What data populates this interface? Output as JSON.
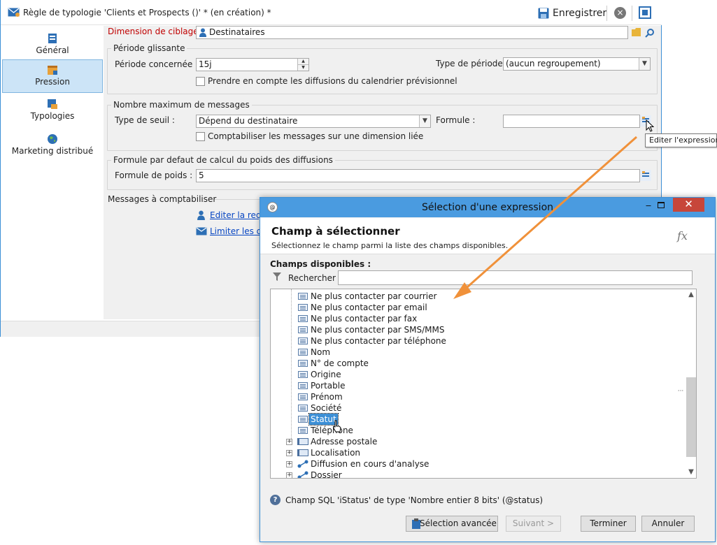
{
  "window": {
    "title": "Règle de typologie 'Clients et Prospects ()' * (en création) *",
    "save_label": "Enregistrer"
  },
  "sidebar": {
    "items": [
      {
        "label": "Général",
        "icon": "general-icon",
        "selected": false
      },
      {
        "label": "Pression",
        "icon": "calendar-icon",
        "selected": true
      },
      {
        "label": "Typologies",
        "icon": "typologies-icon",
        "selected": false
      },
      {
        "label": "Marketing distribué",
        "icon": "globe-icon",
        "selected": false
      }
    ]
  },
  "form": {
    "dimension_label": "Dimension de ciblage :",
    "dimension_value": "Destinataires",
    "periode": {
      "legend": "Période glissante",
      "periode_label": "Période concernée :",
      "periode_value": "15j",
      "type_label": "Type de période :",
      "type_value": "(aucun regroupement)",
      "calendar_checkbox": "Prendre en compte les diffusions du calendrier prévisionnel"
    },
    "max_messages": {
      "legend": "Nombre maximum de messages",
      "seuil_label": "Type de seuil :",
      "seuil_value": "Dépend du destinataire",
      "formule_label": "Formule :",
      "formule_value": "",
      "linked_checkbox": "Comptabiliser les messages sur une dimension liée"
    },
    "poids": {
      "legend": "Formule par defaut de calcul du poids des diffusions",
      "label": "Formule de poids :",
      "value": "5"
    },
    "messages": {
      "legend": "Messages à comptabiliser",
      "link1": "Editer la requ",
      "link2": "Limiter les dif"
    }
  },
  "tooltip": "Editer l'expression",
  "dialog": {
    "title": "Sélection d'une expression",
    "heading": "Champ à sélectionner",
    "subheading": "Sélectionnez le champ parmi la liste des champs disponibles.",
    "fx": "fx",
    "available_label": "Champs disponibles :",
    "search_label": "Rechercher :",
    "search_value": "",
    "tree": [
      {
        "label": "Ne plus contacter par courrier",
        "type": "field"
      },
      {
        "label": "Ne plus contacter par email",
        "type": "field"
      },
      {
        "label": "Ne plus contacter par fax",
        "type": "field"
      },
      {
        "label": "Ne plus contacter par SMS/MMS",
        "type": "field"
      },
      {
        "label": "Ne plus contacter par téléphone",
        "type": "field"
      },
      {
        "label": "Nom",
        "type": "field"
      },
      {
        "label": "N° de compte",
        "type": "field"
      },
      {
        "label": "Origine",
        "type": "field"
      },
      {
        "label": "Portable",
        "type": "field"
      },
      {
        "label": "Prénom",
        "type": "field"
      },
      {
        "label": "Société",
        "type": "field"
      },
      {
        "label": "Statut",
        "type": "field",
        "selected": true
      },
      {
        "label": "Téléphone",
        "type": "field"
      },
      {
        "label": "Adresse postale",
        "type": "group"
      },
      {
        "label": "Localisation",
        "type": "group"
      },
      {
        "label": "Diffusion en cours d'analyse",
        "type": "link"
      },
      {
        "label": "Dossier",
        "type": "link"
      }
    ],
    "sql_info": "Champ SQL 'iStatus' de type 'Nombre entier 8 bits' (@status)",
    "buttons": {
      "advanced": "Sélection avancée",
      "next": "Suivant >",
      "finish": "Terminer",
      "cancel": "Annuler"
    }
  },
  "colors": {
    "accent": "#3c8fd6",
    "selected_sidebar": "#cce4f7",
    "label_red": "#c00000",
    "arrow": "#f0913a",
    "dialog_close": "#c7463a"
  }
}
